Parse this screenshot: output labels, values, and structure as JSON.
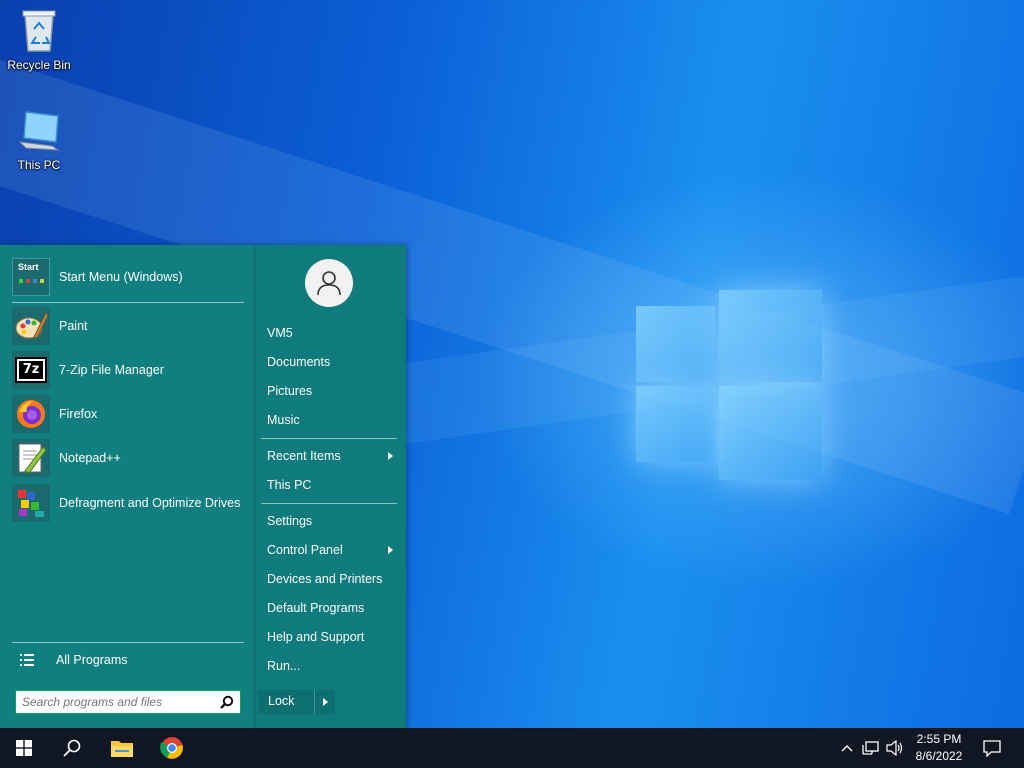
{
  "desktop": {
    "icons": [
      {
        "label": "Recycle Bin",
        "icon": "recycle-bin-icon"
      },
      {
        "label": "This PC",
        "icon": "computer-icon"
      }
    ]
  },
  "start_menu": {
    "pinned": [
      {
        "label": "Start Menu (Windows)",
        "icon": "start-menu-icon"
      },
      {
        "label": "Paint",
        "icon": "paint-icon"
      },
      {
        "label": "7-Zip File Manager",
        "icon": "7zip-icon"
      },
      {
        "label": "Firefox",
        "icon": "firefox-icon"
      },
      {
        "label": "Notepad++",
        "icon": "notepad-plus-plus-icon"
      },
      {
        "label": "Defragment and Optimize Drives",
        "icon": "defrag-icon"
      }
    ],
    "all_programs": "All Programs",
    "search": {
      "placeholder": "Search programs and files"
    },
    "right": {
      "user": "VM5",
      "documents": "Documents",
      "pictures": "Pictures",
      "music": "Music",
      "recent_items": "Recent Items",
      "this_pc": "This PC",
      "settings": "Settings",
      "control_panel": "Control Panel",
      "devices_printers": "Devices and Printers",
      "default_programs": "Default Programs",
      "help_support": "Help and Support",
      "run": "Run..."
    },
    "lock": "Lock",
    "start_tile_text": "Start"
  },
  "taskbar": {
    "clock_time": "2:55 PM",
    "clock_date": "8/6/2022",
    "apps": [
      "file-explorer-icon",
      "chrome-icon"
    ]
  },
  "colors": {
    "menu_bg": "#117f7f",
    "taskbar_bg": "#101622"
  }
}
